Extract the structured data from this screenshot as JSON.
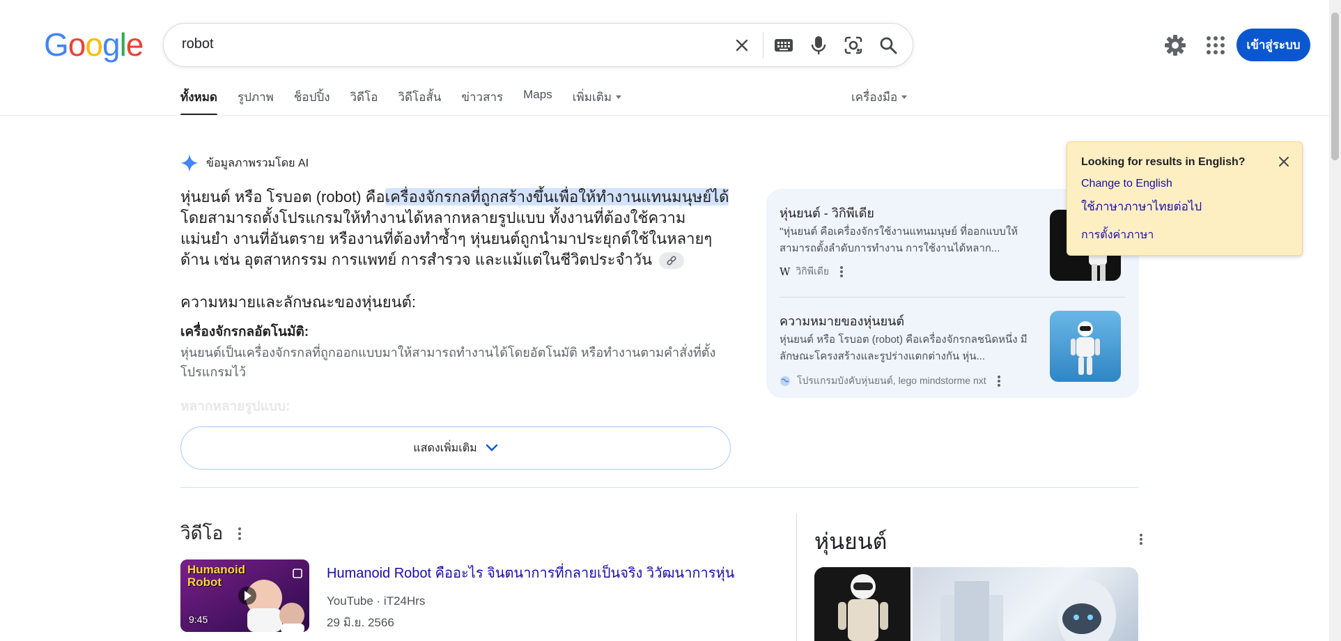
{
  "header": {
    "logo_letters": [
      "G",
      "o",
      "o",
      "g",
      "l",
      "e"
    ],
    "search_query": "robot",
    "signin_label": "เข้าสู่ระบบ"
  },
  "tabs": {
    "items": [
      "ทั้งหมด",
      "รูปภาพ",
      "ช็อปปิ้ง",
      "วิดีโอ",
      "วิดีโอสั้น",
      "ข่าวสาร",
      "Maps",
      "เพิ่มเติม"
    ],
    "tools": "เครื่องมือ"
  },
  "ai_overview": {
    "label": "ข้อมูลภาพรวมโดย AI",
    "para_before": "หุ่นยนต์ หรือ โรบอต (robot) คือ",
    "para_highlight": "เครื่องจักรกลที่ถูกสร้างขึ้นเพื่อให้ทำงานแทนมนุษย์ได้",
    "para_after": " โดยสามารถตั้งโปรแกรมให้ทำงานได้หลากหลายรูปแบบ ทั้งงานที่ต้องใช้ความแม่นยำ งานที่อันตราย หรืองานที่ต้องทำซ้ำๆ หุ่นยนต์ถูกนำมาประยุกต์ใช้ในหลายๆ ด้าน เช่น อุตสาหกรรม การแพทย์ การสำรวจ และแม้แต่ในชีวิตประจำวัน",
    "subheading": "ความหมายและลักษณะของหุ่นยนต์:",
    "bold_item": "เครื่องจักรกลอัตโนมัติ:",
    "bold_desc": "หุ่นยนต์เป็นเครื่องจักรกลที่ถูกออกแบบมาให้สามารถทำงานได้โดยอัตโนมัติ หรือทำงานตามคำสั่งที่ตั้งโปรแกรมไว้",
    "faded_item": "หลากหลายรูปแบบ:",
    "show_more": "แสดงเพิ่มเติม"
  },
  "sources": [
    {
      "title": "หุ่นยนต์ - วิกิพีเดีย",
      "snippet": "\"หุ่นยนต์ คือเครื่องจักรใช้งานแทนมนุษย์ ที่ออกแบบให้สามารถตั้งลำดับการทำงาน การใช้งานได้หลาก...",
      "site": "วิกิพีเดีย"
    },
    {
      "title": "ความหมายของหุ่นยนต์",
      "snippet": "หุ่นยนต์ หรือ โรบอต (robot) คือเครื่องจักรกลชนิดหนึ่ง มีลักษณะโครงสร้างและรูปร่างแตกต่างกัน หุ่น...",
      "site": "โปรแกรมบังคับหุ่นยนต์, lego mindstorme nxt"
    }
  ],
  "language_popup": {
    "title": "Looking for results in English?",
    "link_english": "Change to English",
    "link_thai": "ใช้ภาษาภาษาไทยต่อไป",
    "link_settings": "การตั้งค่าภาษา"
  },
  "videos": {
    "heading": "วิดีโอ",
    "items": [
      {
        "title": "Humanoid Robot คืออะไร จินตนาการที่กลายเป็นจริง วิวัฒนาการหุ่น ...",
        "source": "YouTube · iT24Hrs",
        "date": "29 มิ.ย. 2566",
        "duration": "9:45",
        "thumb_text": "Humanoid Robot"
      }
    ]
  },
  "knowledge_panel": {
    "title": "หุ่นยนต์"
  }
}
